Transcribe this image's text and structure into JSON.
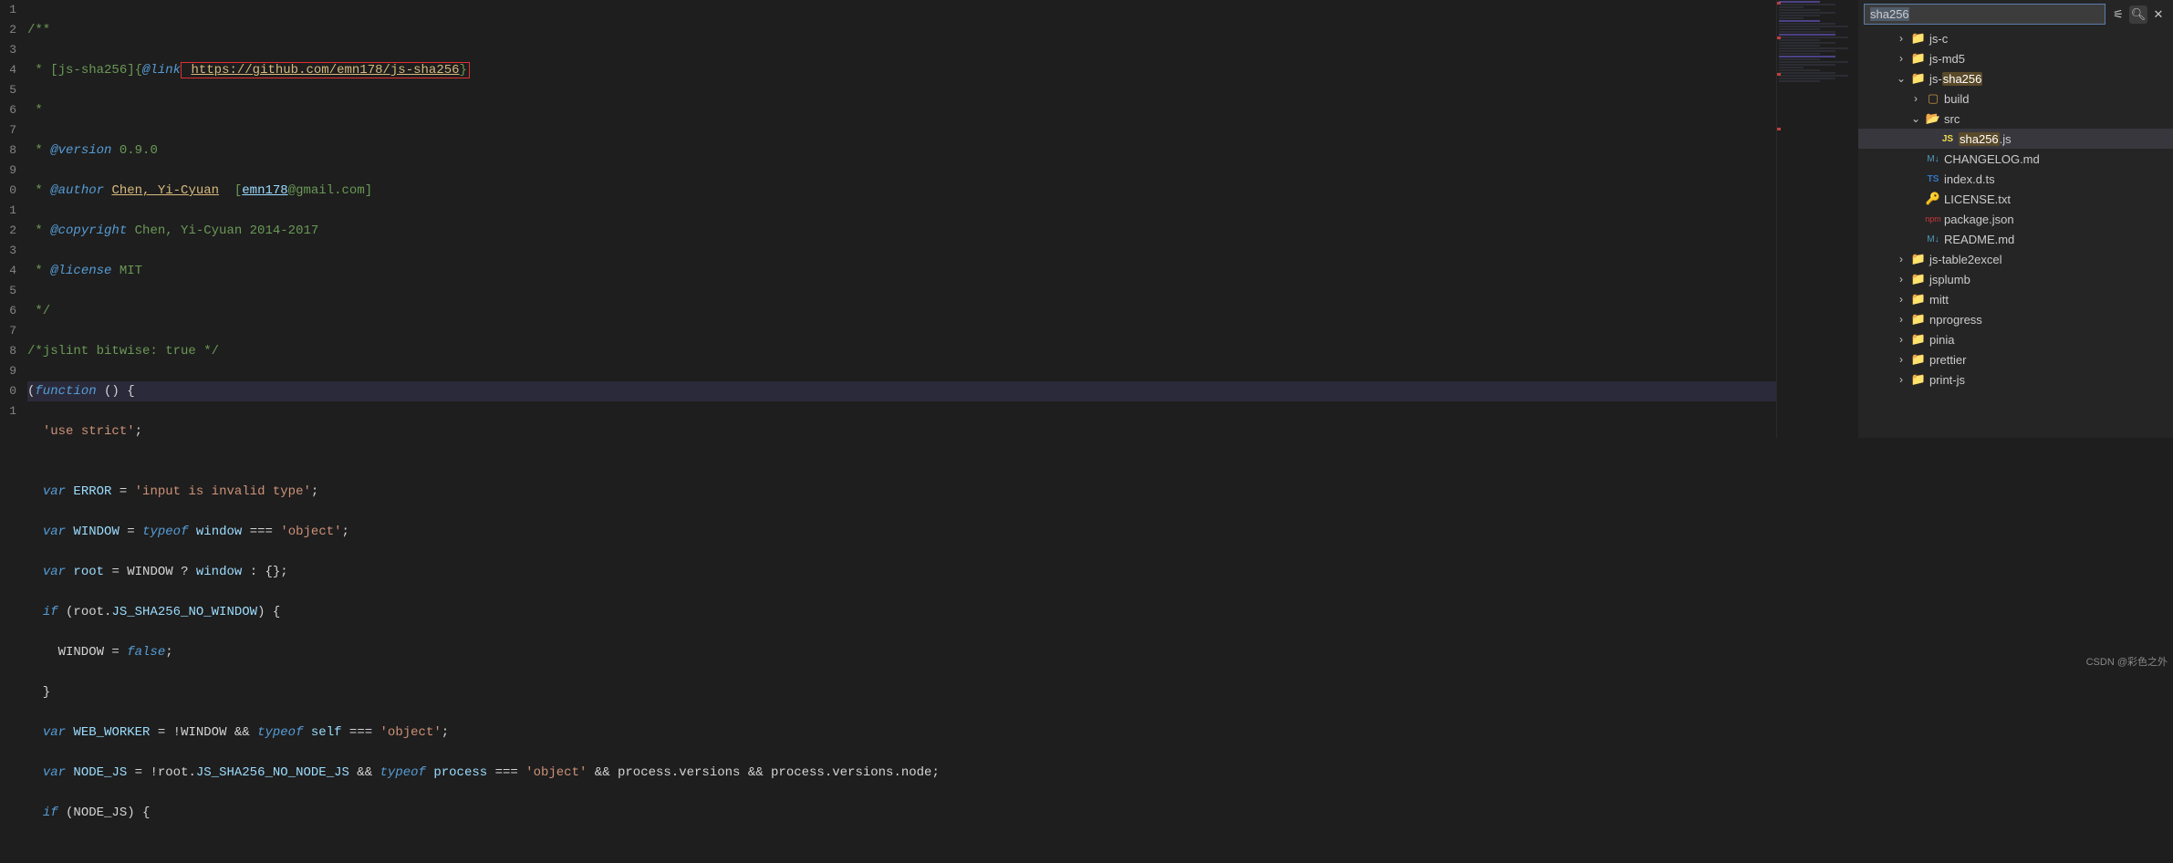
{
  "code_lines": [
    "/**",
    " * [js-sha256]{@link https://github.com/emn178/js-sha256}",
    " *",
    " * @version 0.9.0",
    " * @author Chen, Yi-Cyuan [emn178@gmail.com]",
    " * @copyright Chen, Yi-Cyuan 2014-2017",
    " * @license MIT",
    " */",
    "/*jslint bitwise: true */",
    "(function () {",
    "  'use strict';",
    "",
    "  var ERROR = 'input is invalid type';",
    "  var WINDOW = typeof window === 'object';",
    "  var root = WINDOW ? window : {};",
    "  if (root.JS_SHA256_NO_WINDOW) {",
    "    WINDOW = false;",
    "  }",
    "  var WEB_WORKER = !WINDOW && typeof self === 'object';",
    "  var NODE_JS = !root.JS_SHA256_NO_NODE_JS && typeof process === 'object' && process.versions && process.versions.node;",
    "  if (NODE_JS) {"
  ],
  "jsdoc": {
    "name_tag": "[js-sha256]",
    "link_tag": "@link",
    "link_url": "https://github.com/emn178/js-sha256",
    "version_tag": "@version",
    "version_val": " 0.9.0",
    "author_tag": "@author",
    "author_name": "Chen, Yi-Cyuan",
    "author_email_prefix": "emn178",
    "author_email_suffix": "@gmail.com]",
    "copyright_tag": "@copyright",
    "copyright_val": " Chen, Yi-Cyuan 2014-2017",
    "license_tag": "@license",
    "license_val": " MIT",
    "jslint": "/*jslint bitwise: true */"
  },
  "body": {
    "fn_open_a": "(",
    "fn_kw": "function",
    "fn_open_b": " () {",
    "use_strict": "'use strict'",
    "semi": ";",
    "var_kw": "var",
    "error_name": " ERROR ",
    "eq": "= ",
    "error_str": "'input is invalid type'",
    "window_name": " WINDOW ",
    "typeof_kw": "typeof",
    "window_var": " window ",
    "triple_eq": "=== ",
    "object_str": "'object'",
    "root_name": " root ",
    "root_expr_a": "= WINDOW ? ",
    "root_expr_b": "window",
    "root_expr_c": " : {};",
    "if_kw": "if",
    "if_cond1_a": " (root.",
    "if_cond1_b": "JS_SHA256_NO_WINDOW",
    "if_cond1_c": ") {",
    "win_false_a": "    WINDOW = ",
    "false_kw": "false",
    "close_brace": "  }",
    "webworker_name": " WEB_WORKER ",
    "ww_expr_a": "= !WINDOW && ",
    "self_var": " self ",
    "nodejs_name": " NODE_JS ",
    "nj_expr_a": "= !root.",
    "nj_prop": "JS_SHA256_NO_NODE_JS",
    "nj_expr_b": " && ",
    "process_var": " process ",
    "nj_expr_c": " && process.versions && process.versions.node;",
    "if_cond2": " (NODE_JS) {"
  },
  "search": {
    "value": "sha256"
  },
  "tree": {
    "items": [
      {
        "depth": 2,
        "type": "folder",
        "chevron": "right",
        "label_pre": "js-c",
        "label_hl": "",
        "label_post": ""
      },
      {
        "depth": 2,
        "type": "folder",
        "chevron": "right",
        "label_pre": "js-md5",
        "label_hl": "",
        "label_post": ""
      },
      {
        "depth": 2,
        "type": "folder",
        "chevron": "down",
        "label_pre": "js-",
        "label_hl": "sha256",
        "label_post": ""
      },
      {
        "depth": 3,
        "type": "folder-alt",
        "chevron": "right",
        "label_pre": "build",
        "label_hl": "",
        "label_post": ""
      },
      {
        "depth": 3,
        "type": "folder-src",
        "chevron": "down",
        "label_pre": "src",
        "label_hl": "",
        "label_post": ""
      },
      {
        "depth": 4,
        "type": "file-js",
        "chevron": "",
        "label_pre": "",
        "label_hl": "sha256",
        "label_post": ".js",
        "selected": true
      },
      {
        "depth": 3,
        "type": "file-md",
        "chevron": "",
        "label_pre": "CHANGELOG.md",
        "label_hl": "",
        "label_post": ""
      },
      {
        "depth": 3,
        "type": "file-ts",
        "chevron": "",
        "label_pre": "index.d.ts",
        "label_hl": "",
        "label_post": ""
      },
      {
        "depth": 3,
        "type": "file-lic",
        "chevron": "",
        "label_pre": "LICENSE.txt",
        "label_hl": "",
        "label_post": ""
      },
      {
        "depth": 3,
        "type": "file-npm",
        "chevron": "",
        "label_pre": "package.json",
        "label_hl": "",
        "label_post": ""
      },
      {
        "depth": 3,
        "type": "file-md",
        "chevron": "",
        "label_pre": "README.md",
        "label_hl": "",
        "label_post": ""
      },
      {
        "depth": 2,
        "type": "folder",
        "chevron": "right",
        "label_pre": "js-table2excel",
        "label_hl": "",
        "label_post": ""
      },
      {
        "depth": 2,
        "type": "folder",
        "chevron": "right",
        "label_pre": "jsplumb",
        "label_hl": "",
        "label_post": ""
      },
      {
        "depth": 2,
        "type": "folder",
        "chevron": "right",
        "label_pre": "mitt",
        "label_hl": "",
        "label_post": ""
      },
      {
        "depth": 2,
        "type": "folder",
        "chevron": "right",
        "label_pre": "nprogress",
        "label_hl": "",
        "label_post": ""
      },
      {
        "depth": 2,
        "type": "folder",
        "chevron": "right",
        "label_pre": "pinia",
        "label_hl": "",
        "label_post": ""
      },
      {
        "depth": 2,
        "type": "folder",
        "chevron": "right",
        "label_pre": "prettier",
        "label_hl": "",
        "label_post": ""
      },
      {
        "depth": 2,
        "type": "folder",
        "chevron": "right",
        "label_pre": "print-js",
        "label_hl": "",
        "label_post": ""
      }
    ]
  },
  "watermark": "CSDN @彩色之外"
}
